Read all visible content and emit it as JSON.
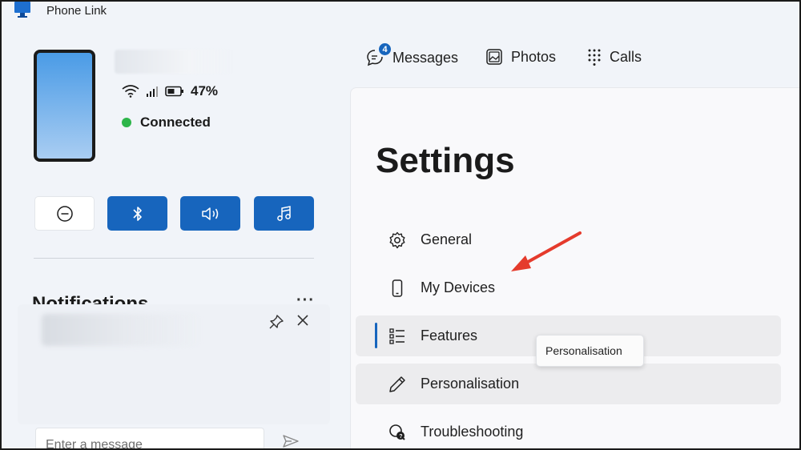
{
  "app": {
    "title": "Phone Link"
  },
  "device": {
    "battery": "47%",
    "status": "Connected"
  },
  "quick_actions": [
    {
      "icon": "do-not-disturb-icon",
      "active": false
    },
    {
      "icon": "bluetooth-icon",
      "active": true
    },
    {
      "icon": "audio-icon",
      "active": true
    },
    {
      "icon": "music-icon",
      "active": true
    }
  ],
  "notifications": {
    "title": "Notifications",
    "more_label": "···",
    "message_placeholder": "Enter a message"
  },
  "nav": {
    "messages": {
      "label": "Messages",
      "badge": "4"
    },
    "photos": {
      "label": "Photos"
    },
    "calls": {
      "label": "Calls"
    }
  },
  "settings": {
    "title": "Settings",
    "items": [
      {
        "label": "General",
        "icon": "gear-icon"
      },
      {
        "label": "My Devices",
        "icon": "phone-icon"
      },
      {
        "label": "Features",
        "icon": "features-list-icon",
        "selected": true
      },
      {
        "label": "Personalisation",
        "icon": "pen-icon",
        "hovered": true
      },
      {
        "label": "Troubleshooting",
        "icon": "troubleshoot-icon"
      }
    ]
  },
  "tooltip": {
    "text": "Personalisation"
  },
  "colors": {
    "accent": "#1765bd",
    "connected": "#2db54a",
    "arrow": "#e53b2c"
  }
}
